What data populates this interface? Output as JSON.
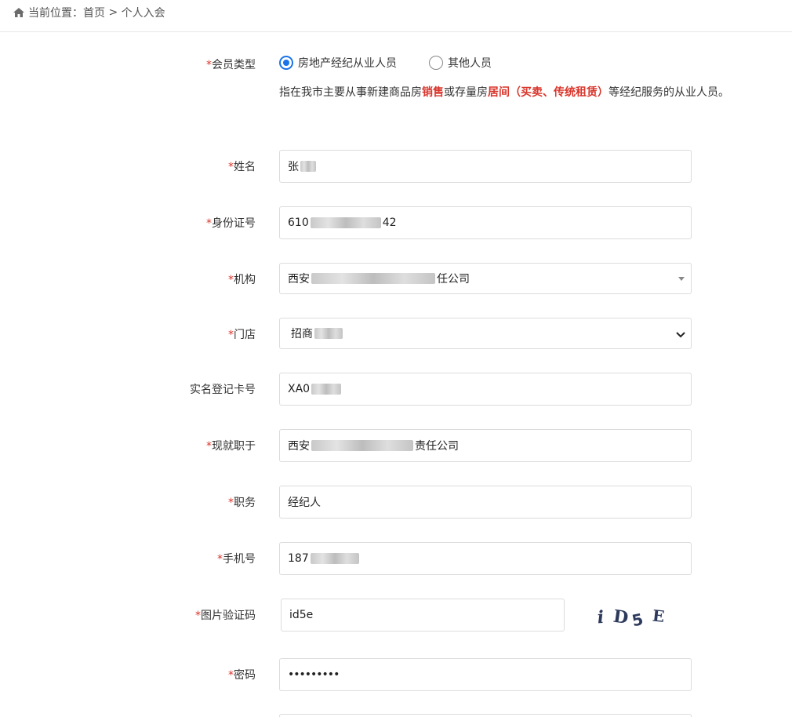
{
  "breadcrumb": {
    "prefix": "当前位置：",
    "home": "首页",
    "separator": " > ",
    "current": "个人入会"
  },
  "member_type": {
    "label": "会员类型",
    "options": [
      "房地产经纪从业人员",
      "其他人员"
    ],
    "selected": 0,
    "hint": {
      "p1": "指在我市主要从事新建商品房",
      "b1": "销售",
      "p2": "或存量房",
      "b2": "居间（买卖、传统租赁）",
      "p3": "等经纪服务的从业人员。"
    }
  },
  "form": {
    "name": {
      "label": "姓名",
      "value": "张"
    },
    "id_number": {
      "label": "身份证号",
      "value_start": "610",
      "value_end": "42"
    },
    "org": {
      "label": "机构",
      "value_start": "西安",
      "value_end": "任公司"
    },
    "store": {
      "label": "门店",
      "value": "招商"
    },
    "reg_card": {
      "label": "实名登记卡号",
      "value": "XA0"
    },
    "employer": {
      "label": "现就职于",
      "value_start": "西安",
      "value_end": "责任公司"
    },
    "position": {
      "label": "职务",
      "value": "经纪人"
    },
    "phone": {
      "label": "手机号",
      "value": "187"
    },
    "captcha": {
      "label": "图片验证码",
      "value": "id5e",
      "image_text": [
        "i",
        "D",
        "5",
        "E"
      ]
    },
    "password": {
      "label": "密码",
      "value": "•••••••••"
    }
  },
  "required_mark": "*",
  "colors": {
    "required": "#d9352b",
    "radio_accent": "#1a73e8"
  }
}
